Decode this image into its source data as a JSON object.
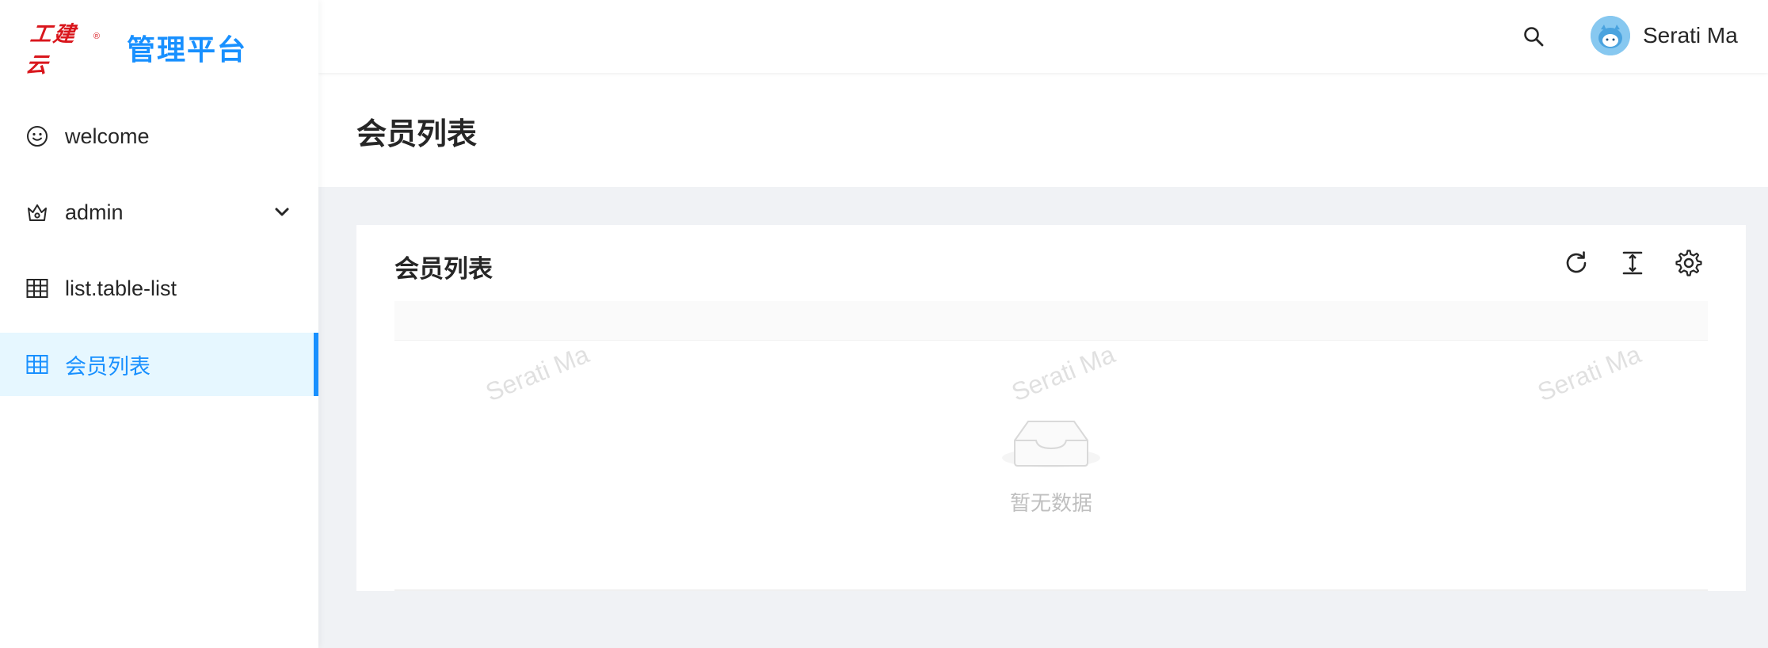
{
  "logo": {
    "mark_text": "工建云",
    "registered": "®",
    "title": "管理平台"
  },
  "sidebar": {
    "items": [
      {
        "label": "welcome",
        "icon": "smile-icon"
      },
      {
        "label": "admin",
        "icon": "crown-icon",
        "expandable": true
      },
      {
        "label": "list.table-list",
        "icon": "table-icon"
      },
      {
        "label": "会员列表",
        "icon": "table-icon",
        "selected": true
      }
    ]
  },
  "header": {
    "username": "Serati Ma",
    "search_icon": "search-icon",
    "avatar_icon": "avatar"
  },
  "page": {
    "title": "会员列表"
  },
  "card": {
    "title": "会员列表",
    "toolbar": [
      "reload-icon",
      "column-height-icon",
      "setting-icon"
    ],
    "empty_text": "暂无数据"
  },
  "watermark": {
    "text": "Serati Ma"
  },
  "colors": {
    "primary": "#1890ff",
    "selected_bg": "#e6f7ff",
    "logo_red": "#d9161c",
    "content_bg": "#f0f2f5"
  }
}
